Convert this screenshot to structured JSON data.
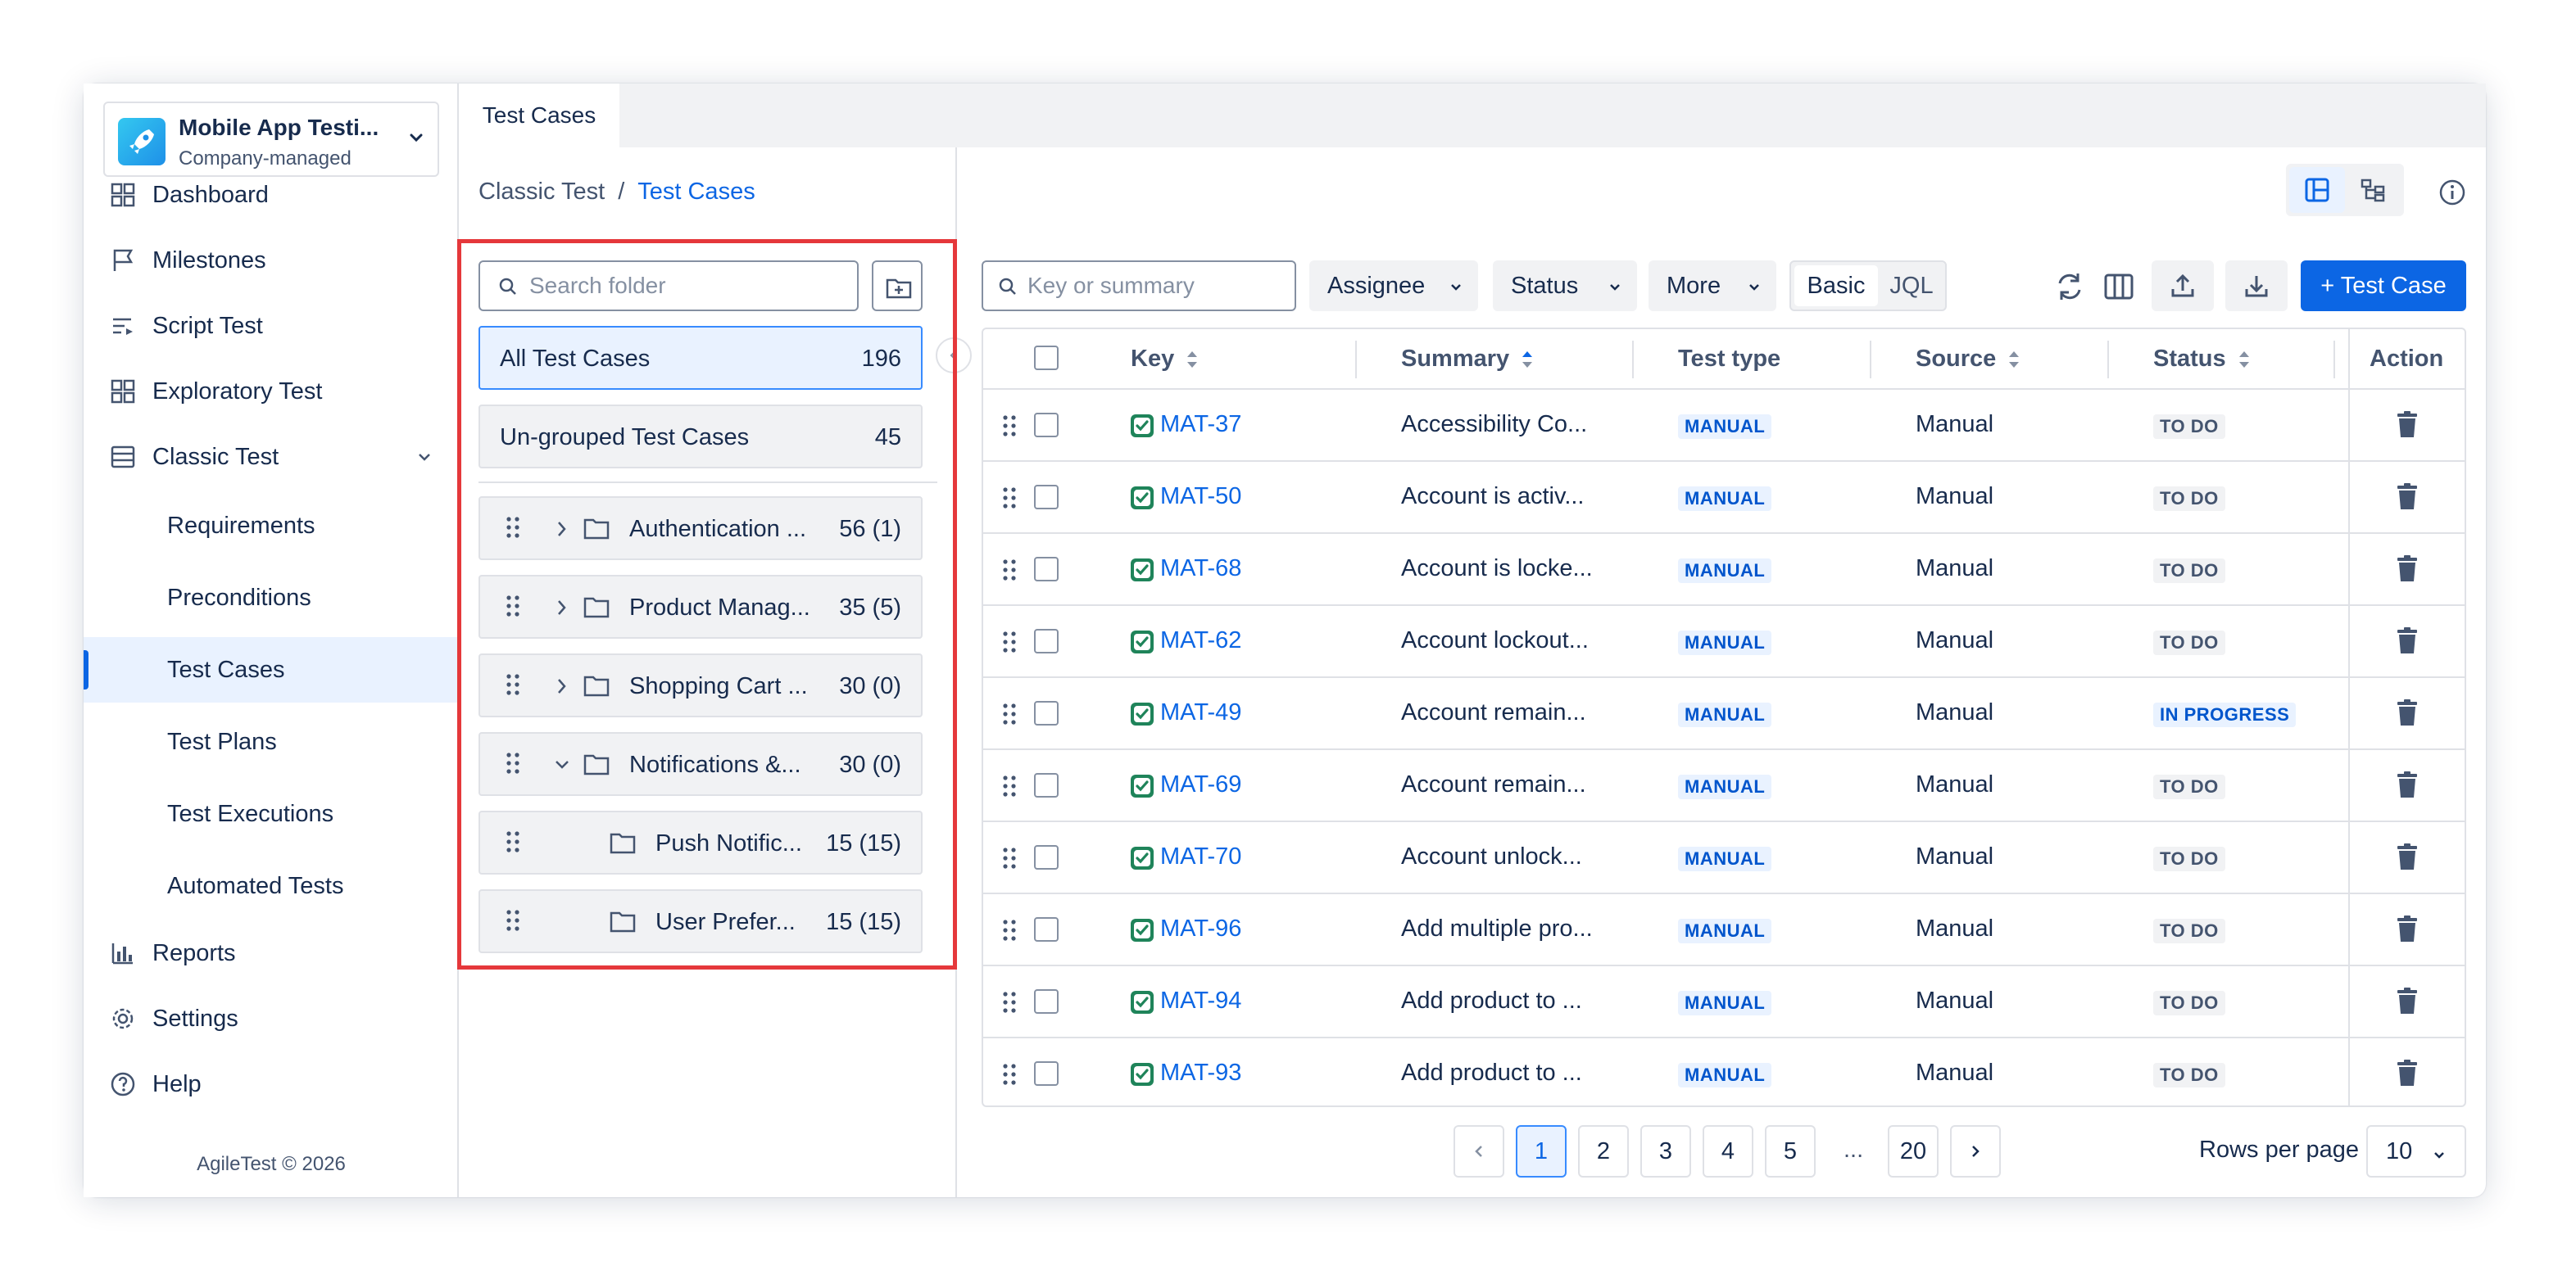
{
  "project": {
    "name": "Mobile App Testi...",
    "type": "Company-managed"
  },
  "sidebar": {
    "items": [
      {
        "label": "Dashboard",
        "icon": "dashboard-icon"
      },
      {
        "label": "Milestones",
        "icon": "flag-icon"
      },
      {
        "label": "Script Test",
        "icon": "script-icon"
      },
      {
        "label": "Exploratory Test",
        "icon": "grid-icon"
      },
      {
        "label": "Classic Test",
        "icon": "table-icon"
      },
      {
        "label": "Requirements"
      },
      {
        "label": "Preconditions"
      },
      {
        "label": "Test Cases"
      },
      {
        "label": "Test Plans"
      },
      {
        "label": "Test Executions"
      },
      {
        "label": "Automated Tests"
      },
      {
        "label": "Reports",
        "icon": "chart-icon"
      },
      {
        "label": "Settings",
        "icon": "gear-icon"
      },
      {
        "label": "Help",
        "icon": "help-icon"
      }
    ],
    "active": "Test Cases",
    "footer": "AgileTest © 2026"
  },
  "tab": {
    "label": "Test Cases"
  },
  "breadcrumb": {
    "parent": "Classic Test",
    "separator": "/",
    "current": "Test Cases"
  },
  "folders": {
    "search_placeholder": "Search folder",
    "all": {
      "label": "All Test Cases",
      "count": "196"
    },
    "ungrouped": {
      "label": "Un-grouped Test Cases",
      "count": "45"
    },
    "items": [
      {
        "name": "Authentication ...",
        "count": "56 (1)"
      },
      {
        "name": "Product Manag...",
        "count": "35 (5)"
      },
      {
        "name": "Shopping Cart ...",
        "count": "30 (0)"
      },
      {
        "name": "Notifications &...",
        "count": "30 (0)"
      },
      {
        "name": "Push Notific...",
        "count": "15 (15)"
      },
      {
        "name": "User Prefer...",
        "count": "15 (15)"
      }
    ]
  },
  "toolbar": {
    "search_placeholder": "Key or summary",
    "assignee": "Assignee",
    "status": "Status",
    "more": "More",
    "basic": "Basic",
    "jql": "JQL",
    "new_case": "+ Test Case"
  },
  "table": {
    "headers": {
      "key": "Key",
      "summary": "Summary",
      "type": "Test type",
      "source": "Source",
      "status": "Status",
      "action": "Action"
    },
    "rows": [
      {
        "key": "MAT-37",
        "summary": "Accessibility Co...",
        "type": "MANUAL",
        "source": "Manual",
        "status": "TO DO"
      },
      {
        "key": "MAT-50",
        "summary": "Account is activ...",
        "type": "MANUAL",
        "source": "Manual",
        "status": "TO DO"
      },
      {
        "key": "MAT-68",
        "summary": "Account is locke...",
        "type": "MANUAL",
        "source": "Manual",
        "status": "TO DO"
      },
      {
        "key": "MAT-62",
        "summary": "Account lockout...",
        "type": "MANUAL",
        "source": "Manual",
        "status": "TO DO"
      },
      {
        "key": "MAT-49",
        "summary": "Account remain...",
        "type": "MANUAL",
        "source": "Manual",
        "status": "IN PROGRESS"
      },
      {
        "key": "MAT-69",
        "summary": "Account remain...",
        "type": "MANUAL",
        "source": "Manual",
        "status": "TO DO"
      },
      {
        "key": "MAT-70",
        "summary": "Account unlock...",
        "type": "MANUAL",
        "source": "Manual",
        "status": "TO DO"
      },
      {
        "key": "MAT-96",
        "summary": "Add multiple pro...",
        "type": "MANUAL",
        "source": "Manual",
        "status": "TO DO"
      },
      {
        "key": "MAT-94",
        "summary": "Add product to ...",
        "type": "MANUAL",
        "source": "Manual",
        "status": "TO DO"
      },
      {
        "key": "MAT-93",
        "summary": "Add product to ...",
        "type": "MANUAL",
        "source": "Manual",
        "status": "TO DO"
      }
    ]
  },
  "pagination": {
    "pages": [
      "1",
      "2",
      "3",
      "4",
      "5"
    ],
    "ellipsis": "...",
    "last": "20",
    "current": "1",
    "rows_label": "Rows per page",
    "rows_value": "10"
  },
  "colors": {
    "accent": "#0c66e4",
    "highlight": "#e5383b",
    "key_icon": "#22a06b"
  }
}
